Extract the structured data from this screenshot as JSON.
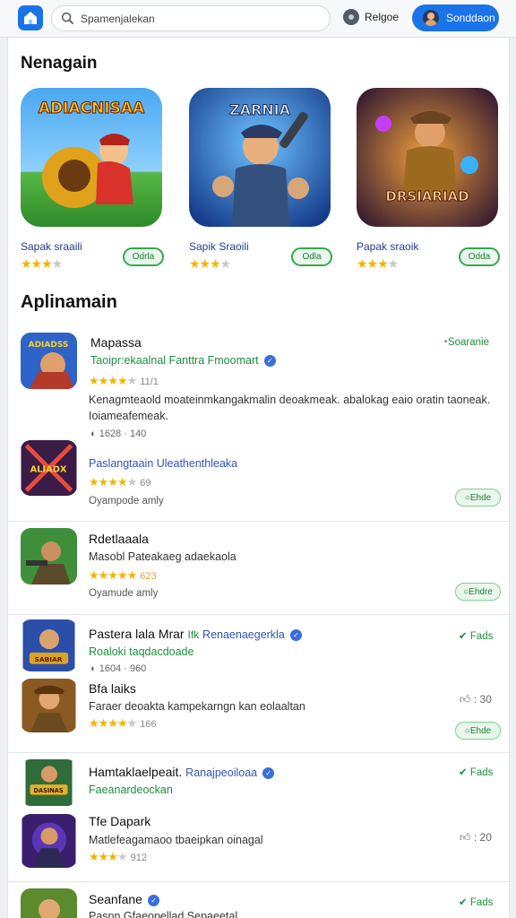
{
  "topbar": {
    "search_placeholder": "Spamenjalekan",
    "help_label": "Relgoe",
    "signin_label": "Sonddaon"
  },
  "sections": {
    "featured_title": "Nenagain",
    "list_title": "Aplinamain"
  },
  "featured": [
    {
      "art_text": "ADIACNISAA",
      "name": "Sapak sraaili",
      "rating": 3.5,
      "badge": "Odrla"
    },
    {
      "art_text": "ZARNIA",
      "name": "Sapik Sraoili",
      "rating": 3.5,
      "badge": "Odla"
    },
    {
      "art_text": "DRSIARIAD",
      "name": "Papak sraoik",
      "rating": 3.5,
      "badge": "Odda"
    }
  ],
  "list": [
    {
      "thumb_text": "ADIADSS",
      "title": "Mapassa",
      "tag": "Soaranie",
      "subtitle": "Taoipr:ekaalnal Fanttra Fmoomart",
      "rating": 4,
      "rating_count": "11/1",
      "description": "Kenagmteaold moateinmkangakmalin deoakmeak. abalokag eaio oratin taoneak. Ioiameafemeak.",
      "meta": "1628  ·  140"
    },
    {
      "thumb_text": "ALIADX",
      "developer": "Paslangtaain Uleathenthleaka",
      "rating": 4,
      "rating_count": "69",
      "category": "Oyampode amly",
      "button": "Ehde"
    },
    {
      "thumb_text": "",
      "title": "Rdetlaaala",
      "description": "Masobl Pateakaeg adaekaola",
      "rating": 4,
      "rating_count": "623",
      "category": "Oyamude amly",
      "button": "Ehdre"
    },
    {
      "thumb_text": "SABIAR",
      "title": "Pastera lala Mrar",
      "title_extra": "Ifk",
      "developer": "Renaenaegerkla",
      "subtitle": "Roaloki taqdacdoade",
      "meta": "1604  ·  960",
      "tag": "Fads"
    },
    {
      "thumb_text": "",
      "title": "Bfa laiks",
      "description": "Faraer deoakta kampekarngn kan eolaaltan",
      "rating": 3.5,
      "rating_count": "166",
      "likes": "30",
      "button": "Ehde"
    },
    {
      "thumb_text": "DASINAS",
      "title": "Hamtaklaelpeait.",
      "developer": "Ranajpeoiloaa",
      "subtitle": "Faeanardeockan",
      "tag": "Fads"
    },
    {
      "thumb_text": "",
      "title": "Tfe Dapark",
      "description": "Matlefeagamaoo tbaeipkan oinagal",
      "rating": 3,
      "rating_count": "912",
      "likes": "20"
    },
    {
      "thumb_text": "",
      "title": "Seanfane",
      "description": "Paspn Gfaeopellad Sepaeetal",
      "tag": "Fads"
    }
  ],
  "colors": {
    "accent": "#1a73e8",
    "install_green": "#34a853",
    "star": "#f2b400"
  }
}
